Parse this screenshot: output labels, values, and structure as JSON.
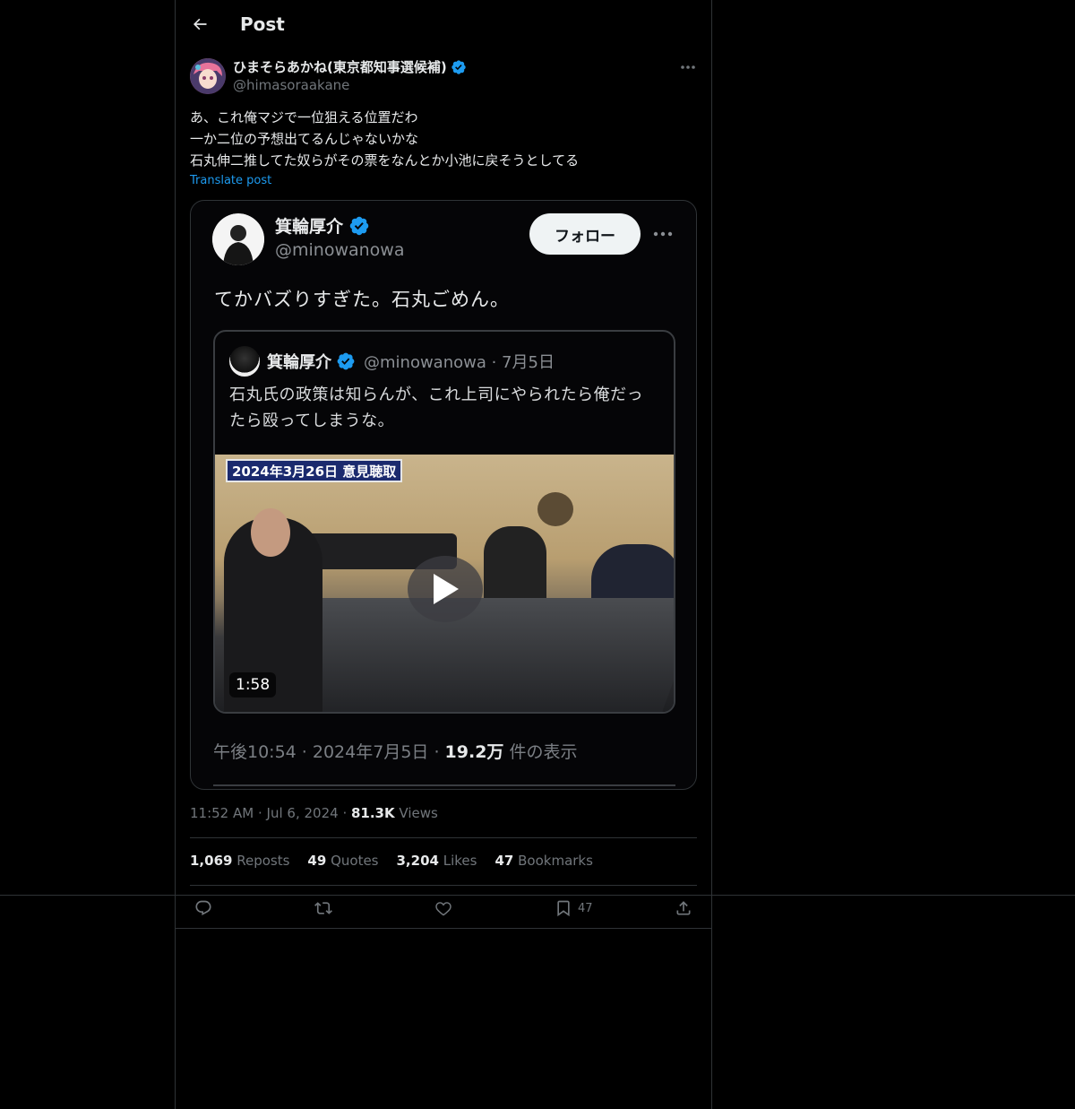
{
  "header": {
    "title": "Post"
  },
  "author": {
    "name": "ひまそらあかね(東京都知事選候補)",
    "handle": "@himasoraakane",
    "verified": true
  },
  "post": {
    "lines": [
      "あ、これ俺マジで一位狙える位置だわ",
      "一か二位の予想出てるんじゃないかな",
      "石丸伸二推してた奴らがその票をなんとか小池に戻そうとしてる"
    ],
    "translate_label": "Translate post"
  },
  "media": {
    "name": "箕輪厚介",
    "handle": "@minowanowa",
    "follow_label": "フォロー",
    "text": "てかバズりすぎた。石丸ごめん。",
    "quote": {
      "name": "箕輪厚介",
      "handle_date": "@minowanowa · 7月5日",
      "text": "石丸氏の政策は知らんが、これ上司にやられたら俺だったら殴ってしまうな。",
      "banner": "2024年3月26日 意見聴取",
      "duration": "1:58"
    },
    "meta_prefix": "午後10:54 · 2024年7月5日 · ",
    "meta_views": "19.2万",
    "meta_suffix": " 件の表示"
  },
  "meta": {
    "time": "11:52 AM",
    "date": "Jul 6, 2024",
    "views_count": "81.3K",
    "views_label": "Views"
  },
  "stats": {
    "reposts": {
      "count": "1,069",
      "label": "Reposts"
    },
    "quotes": {
      "count": "49",
      "label": "Quotes"
    },
    "likes": {
      "count": "3,204",
      "label": "Likes"
    },
    "bookmarks": {
      "count": "47",
      "label": "Bookmarks"
    }
  },
  "actions": {
    "bookmark_count": "47"
  },
  "colors": {
    "accent": "#1d9bf0",
    "verified": "#1d9bf0",
    "background": "#000000",
    "border": "#2f3336",
    "muted": "#71767b"
  }
}
